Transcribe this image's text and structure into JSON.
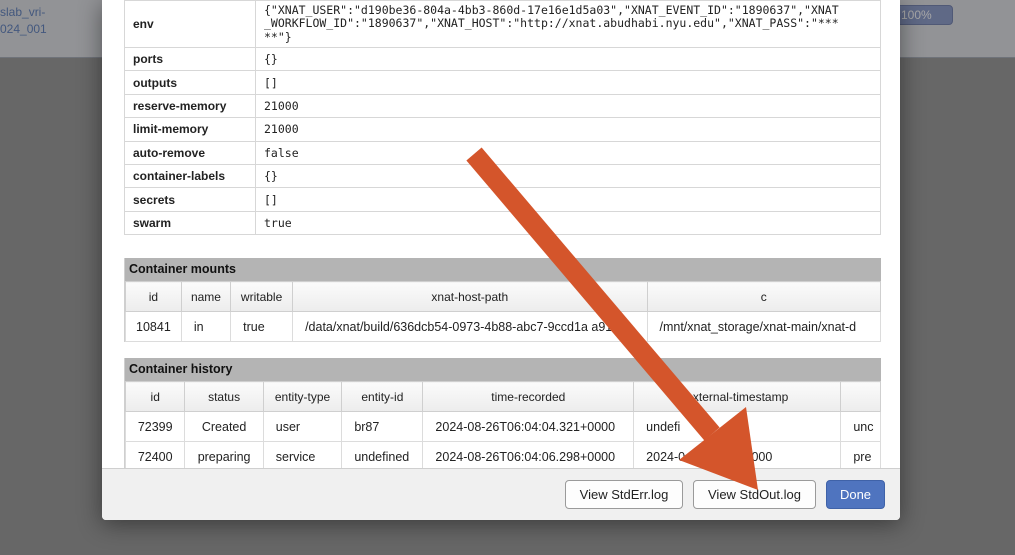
{
  "background": {
    "link_line1": "slab_vri-",
    "link_line2": "024_001",
    "progress": "100%"
  },
  "properties": [
    {
      "key": "env",
      "value": "{\"XNAT_USER\":\"d190be36-804a-4bb3-860d-17e16e1d5a03\",\"XNAT_EVENT_ID\":\"1890637\",\"XNAT_WORKFLOW_ID\":\"1890637\",\"XNAT_HOST\":\"http://xnat.abudhabi.nyu.edu\",\"XNAT_PASS\":\"*****\"}"
    },
    {
      "key": "ports",
      "value": "{}"
    },
    {
      "key": "outputs",
      "value": "[]"
    },
    {
      "key": "reserve-memory",
      "value": "21000"
    },
    {
      "key": "limit-memory",
      "value": "21000"
    },
    {
      "key": "auto-remove",
      "value": "false"
    },
    {
      "key": "container-labels",
      "value": "{}"
    },
    {
      "key": "secrets",
      "value": "[]"
    },
    {
      "key": "swarm",
      "value": "true"
    }
  ],
  "env_lines": [
    "{\"XNAT_USER\":\"d190be36-804a-4bb3-860d-17e16e1d5a03\",\"XNAT_EVENT_ID\":\"1890637\",\"XNAT",
    "_WORKFLOW_ID\":\"1890637\",\"XNAT_HOST\":\"http://xnat.abudhabi.nyu.edu\",\"XNAT_PASS\":\"***",
    "**\"}"
  ],
  "mounts": {
    "title": "Container mounts",
    "columns": [
      "id",
      "name",
      "writable",
      "xnat-host-path",
      "c"
    ],
    "rows": [
      [
        "10841",
        "in",
        "true",
        "/data/xnat/build/636dcb54-0973-4b88-abc7-9ccd1a  a91e",
        "/mnt/xnat_storage/xnat-main/xnat-d"
      ]
    ]
  },
  "history": {
    "title": "Container history",
    "columns": [
      "id",
      "status",
      "entity-type",
      "entity-id",
      "time-recorded",
      "external-timestamp",
      ""
    ],
    "rows": [
      [
        "72399",
        "Created",
        "user",
        "br87",
        "2024-08-26T06:04:04.321+0000",
        "undefi",
        "unc"
      ],
      [
        "72400",
        "preparing",
        "service",
        "undefined",
        "2024-08-26T06:04:06.298+0000",
        "2024-0   4:04.539+0000",
        "pre"
      ]
    ]
  },
  "footer": {
    "stderr_label": "View StdErr.log",
    "stdout_label": "View StdOut.log",
    "done_label": "Done"
  },
  "colors": {
    "arrow": "#d4552b",
    "primary_button": "#4f74bf",
    "section_header": "#b4b4b4"
  }
}
